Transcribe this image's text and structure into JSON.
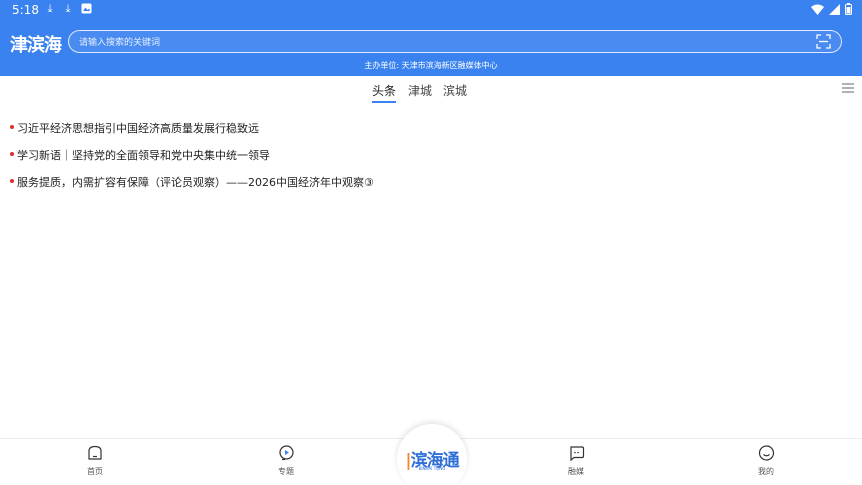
{
  "status_bar": {
    "time": "5:18"
  },
  "header": {
    "logo": "津滨海",
    "search_placeholder": "请输入搜索的关键词",
    "sponsor": "主办单位: 天津市滨海新区融媒体中心"
  },
  "tabs": [
    {
      "label": "头条",
      "active": true
    },
    {
      "label": "津城",
      "active": false
    },
    {
      "label": "滨城",
      "active": false
    }
  ],
  "news": [
    "习近平经济思想指引中国经济高质量发展行稳致远",
    "学习新语｜坚持党的全面领导和党中央集中统一领导",
    "服务提质，内需扩容有保障（评论员观察）——2026中国经济年中观察③"
  ],
  "bottom_nav": {
    "home": "首页",
    "topics": "专题",
    "center_logo": "滨海通",
    "center_logo_accent": "|",
    "center_sub": "BINHAI TONG",
    "media": "融媒",
    "mine": "我的"
  },
  "colors": {
    "brand_blue": "#3a82f0",
    "news_dot": "#e0302a"
  }
}
